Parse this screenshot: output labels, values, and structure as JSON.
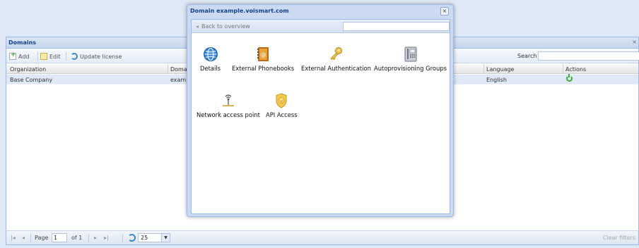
{
  "background_panel": {
    "title": "Domains",
    "toolbar": {
      "add_label": "Add",
      "edit_label": "Edit",
      "update_license_label": "Update license",
      "search_label": "Search"
    },
    "columns": [
      "Organization",
      "Domai",
      "Language",
      "Actions"
    ],
    "rows": [
      {
        "organization": "Base Company",
        "domain": "examp",
        "language": "English",
        "action_icon": "power-icon"
      }
    ],
    "pager": {
      "page_label": "Page",
      "page_value": "1",
      "of_label": "of 1",
      "page_size": "25",
      "clear_filters": "Clear filters"
    }
  },
  "window": {
    "title": "Domain example.voismart.com",
    "back_label": "Back to overview",
    "tiles": [
      {
        "label": "Details",
        "icon": "globe-icon"
      },
      {
        "label": "External Phonebooks",
        "icon": "phonebook-icon"
      },
      {
        "label": "External Authentication",
        "icon": "key-icon"
      },
      {
        "label": "Autoprovisioning Groups",
        "icon": "desk-phone-icon"
      },
      {
        "label": "Network access point",
        "icon": "antenna-icon"
      },
      {
        "label": "API Access",
        "icon": "shield-badge-icon"
      }
    ]
  },
  "colors": {
    "header_text": "#15428b",
    "panel_border": "#99bbe8",
    "row_selected": "#dfe8f6",
    "power_green": "#3caa3c"
  }
}
